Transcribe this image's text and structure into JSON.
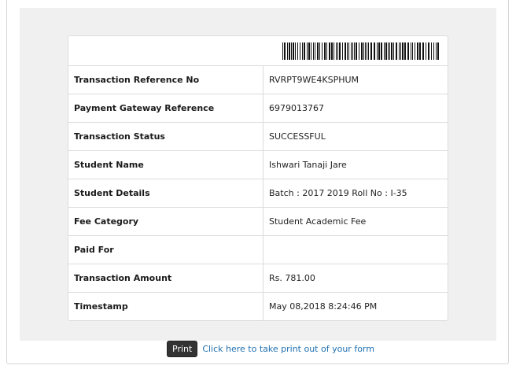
{
  "rows": [
    {
      "label": "Transaction Reference No",
      "value": "RVRPT9WE4KSPHUM"
    },
    {
      "label": "Payment Gateway Reference",
      "value": "6979013767"
    },
    {
      "label": "Transaction Status",
      "value": "SUCCESSFUL"
    },
    {
      "label": "Student Name",
      "value": "Ishwari Tanaji Jare"
    },
    {
      "label": "Student Details",
      "value": "Batch : 2017 2019 Roll No : I-35"
    },
    {
      "label": "Fee Category",
      "value": "Student Academic Fee"
    },
    {
      "label": "Paid For",
      "value": ""
    },
    {
      "label": "Transaction Amount",
      "value": "Rs. 781.00"
    },
    {
      "label": "Timestamp",
      "value": "May 08,2018 8:24:46 PM"
    }
  ],
  "footer": {
    "print_label": "Print",
    "print_link": "Click here to take print out of your form"
  }
}
